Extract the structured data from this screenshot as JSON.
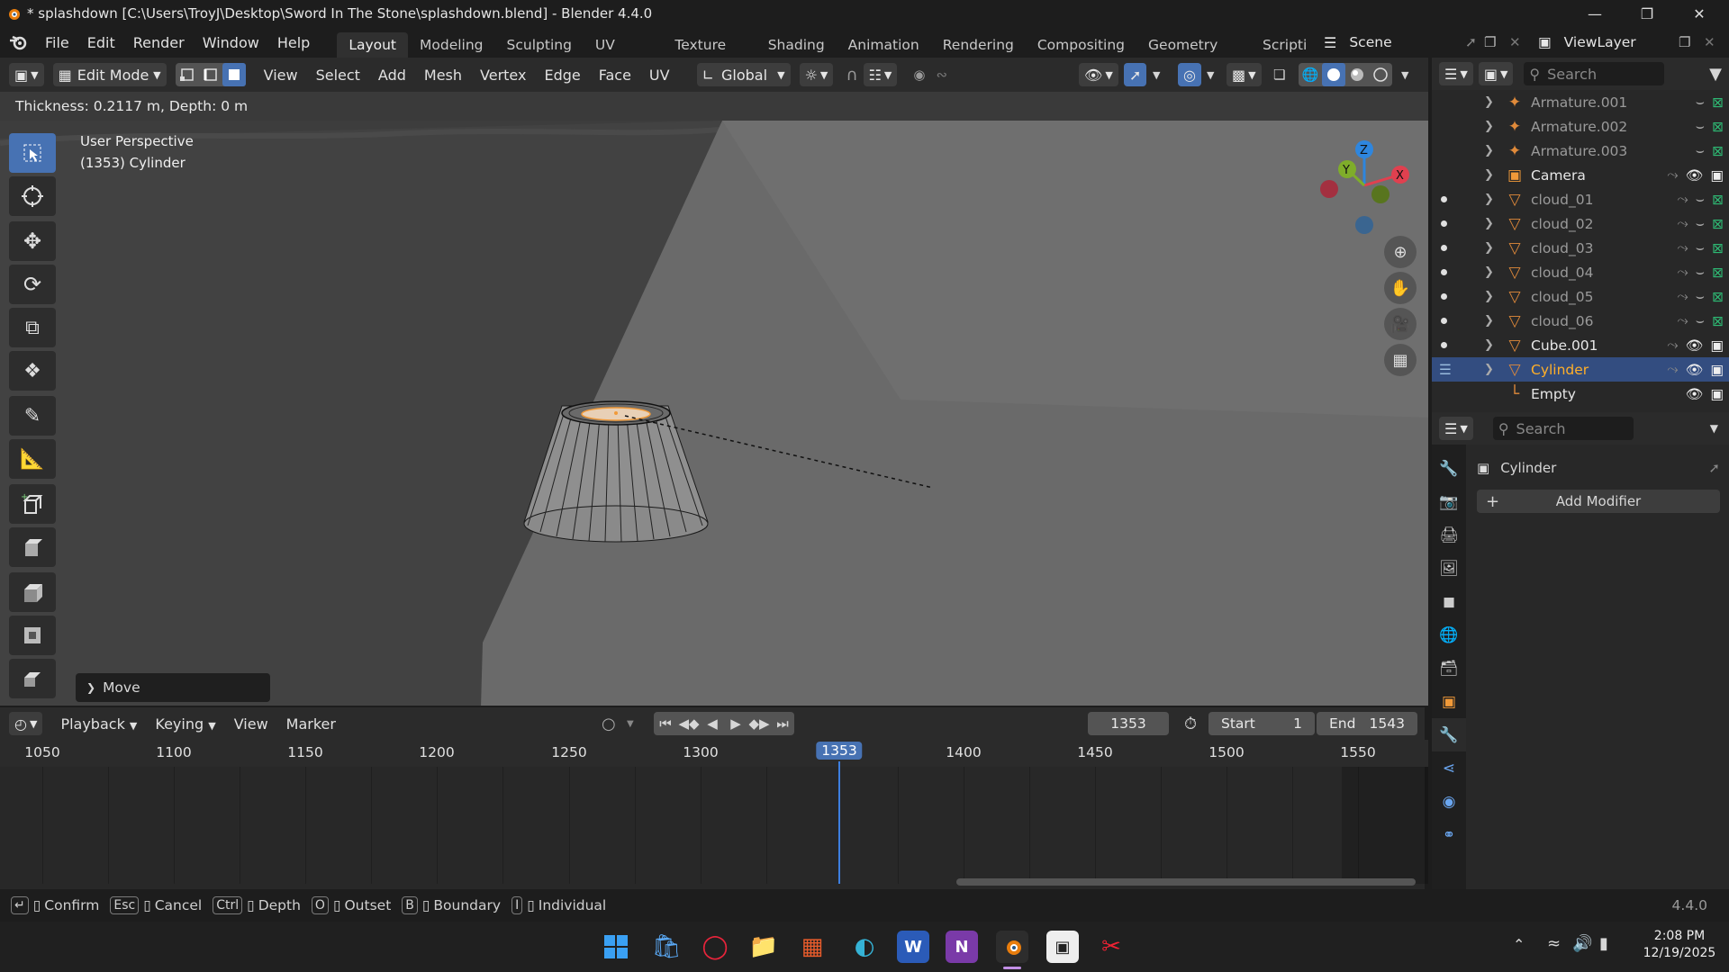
{
  "window": {
    "title": "* splashdown [C:\\Users\\TroyJ\\Desktop\\Sword In The Stone\\splashdown.blend] - Blender 4.4.0",
    "controls": [
      "minimize-icon",
      "maximize-icon",
      "close-icon"
    ]
  },
  "menubar": {
    "items": [
      "File",
      "Edit",
      "Render",
      "Window",
      "Help"
    ],
    "workspaces": [
      "Layout",
      "Modeling",
      "Sculpting",
      "UV Editing",
      "Texture Paint",
      "Shading",
      "Animation",
      "Rendering",
      "Compositing",
      "Geometry Nodes",
      "Scripti"
    ],
    "active_workspace": "Layout",
    "scene": "Scene",
    "view_layer": "ViewLayer"
  },
  "viewport": {
    "mode": "Edit Mode",
    "menus": [
      "View",
      "Select",
      "Add",
      "Mesh",
      "Vertex",
      "Edge",
      "Face",
      "UV"
    ],
    "transform_orientation": "Global",
    "operator_status": "Thickness: 0.2117 m, Depth: 0 m",
    "view_name": "User Perspective",
    "object_info": "(1353) Cylinder",
    "last_operator": "Move",
    "gizmo_axes": {
      "x": "X",
      "y": "Y",
      "z": "Z"
    }
  },
  "outliner": {
    "search_placeholder": "Search",
    "items": [
      {
        "name": "Armature.001",
        "icon": "armature-icon",
        "dim": true
      },
      {
        "name": "Armature.002",
        "icon": "armature-icon",
        "dim": true
      },
      {
        "name": "Armature.003",
        "icon": "armature-icon",
        "dim": true
      },
      {
        "name": "Camera",
        "icon": "camera-icon",
        "dim": false
      },
      {
        "name": "cloud_01",
        "icon": "mesh-icon",
        "dim": true
      },
      {
        "name": "cloud_02",
        "icon": "mesh-icon",
        "dim": true
      },
      {
        "name": "cloud_03",
        "icon": "mesh-icon",
        "dim": true
      },
      {
        "name": "cloud_04",
        "icon": "mesh-icon",
        "dim": true
      },
      {
        "name": "cloud_05",
        "icon": "mesh-icon",
        "dim": true
      },
      {
        "name": "cloud_06",
        "icon": "mesh-icon",
        "dim": true
      },
      {
        "name": "Cube.001",
        "icon": "mesh-icon",
        "dim": false
      },
      {
        "name": "Cylinder",
        "icon": "mesh-icon",
        "dim": false,
        "selected": true
      },
      {
        "name": "Empty",
        "icon": "empty-icon",
        "dim": false
      }
    ]
  },
  "properties": {
    "search_placeholder": "Search",
    "object_name": "Cylinder",
    "add_modifier_label": "Add Modifier"
  },
  "timeline": {
    "menus": [
      "Playback",
      "Keying",
      "View",
      "Marker"
    ],
    "current_frame": "1353",
    "start_label": "Start",
    "start_value": "1",
    "end_label": "End",
    "end_value": "1543",
    "ruler_labels": [
      "1050",
      "1100",
      "1150",
      "1200",
      "1250",
      "1300",
      "1353",
      "1400",
      "1450",
      "1500",
      "1550"
    ]
  },
  "statusbar": {
    "hints": [
      {
        "key": "↵",
        "label": "Confirm"
      },
      {
        "key": "Esc",
        "label": "Cancel"
      },
      {
        "key": "Ctrl",
        "label": "Depth"
      },
      {
        "key": "O",
        "label": "Outset"
      },
      {
        "key": "B",
        "label": "Boundary"
      },
      {
        "key": "I",
        "label": "Individual"
      }
    ],
    "version": "4.4.0"
  },
  "taskbar": {
    "time": "2:08 PM",
    "date": "12/19/2025"
  },
  "colors": {
    "accent_blue": "#4772b3",
    "selection_orange": "#ffaf29",
    "playhead_blue": "#3d7fe0",
    "axis_x": "#e0404f",
    "axis_y": "#7fad2a",
    "axis_z": "#2e86de"
  }
}
